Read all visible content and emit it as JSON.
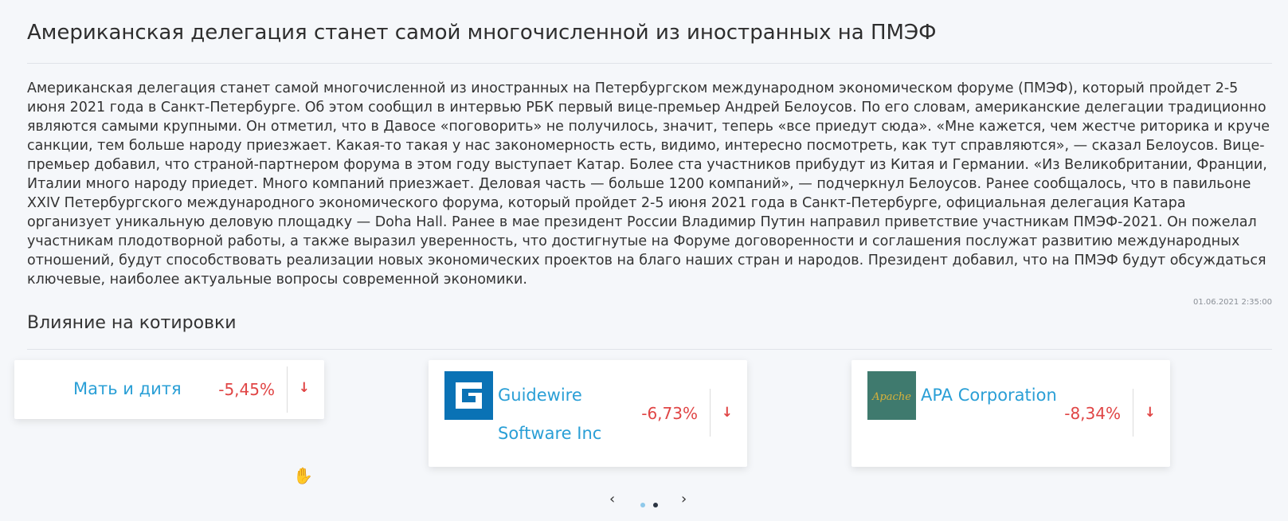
{
  "news": {
    "title": "Американская делегация станет самой многочисленной из иностранных на ПМЭФ",
    "body": "Американская делегация станет самой многочисленной из иностранных на Петербургском международном экономическом форуме (ПМЭФ), который пройдет 2-5 июня 2021 года в Санкт-Петербурге. Об этом сообщил в интервью РБК первый вице-премьер Андрей Белоусов. По его словам, американские делегации традиционно являются самыми крупными. Он отметил, что в Давосе «поговорить» не получилось, значит, теперь «все приедут сюда». «Мне кажется, чем жестче риторика и круче санкции, тем больше народу приезжает. Какая-то такая у нас закономерность есть, видимо, интересно посмотреть, как тут справляются», — сказал Белоусов. Вице-премьер добавил, что страной-партнером форума в этом году выступает Катар. Более ста участников прибудут из Китая и Германии. «Из Великобритании, Франции, Италии много народу приедет. Много компаний приезжает. Деловая часть — больше 1200 компаний», — подчеркнул Белоусов. Ранее сообщалось, что в павильоне XXIV Петербургского международного экономического форума, который пройдет 2-5 июня 2021 года в Санкт-Петербурге, официальная делегация Катара организует уникальную деловую площадку — Doha Hall. Ранее в мае президент России Владимир Путин направил приветствие участникам ПМЭФ-2021. Он пожелал участникам плодотворной работы, а также выразил уверенность, что достигнутые на Форуме договоренности и соглашения послужат развитию международных отношений, будут способствовать реализации новых экономических проектов на благо наших стран и народов. Президент добавил, что на ПМЭФ будут обсуждаться ключевые, наиболее актуальные вопросы современной экономики.",
    "timestamp": "01.06.2021 2:35:00"
  },
  "quotes": {
    "section_title": "Влияние на котировки",
    "cards": [
      {
        "name": "Мать и дитя",
        "change": "-5,45%",
        "direction_icon": "arrow-down-icon"
      },
      {
        "name": "Guidewire Software Inc",
        "change": "-6,73%",
        "direction_icon": "arrow-down-icon",
        "logo_icon": "guidewire-logo",
        "logo_color": "#0a72b5"
      },
      {
        "name": "APA Corporation",
        "change": "-8,34%",
        "direction_icon": "arrow-down-icon",
        "logo_icon": "apache-logo",
        "logo_color": "#3f7a6e",
        "logo_text": "Apache"
      }
    ]
  },
  "carousel": {
    "prev_icon": "chevron-left-icon",
    "next_icon": "chevron-right-icon",
    "page_count": 2,
    "active_page": 2
  },
  "colors": {
    "link": "#2a9fd6",
    "negative": "#e04545",
    "background": "#f5f7fa"
  }
}
